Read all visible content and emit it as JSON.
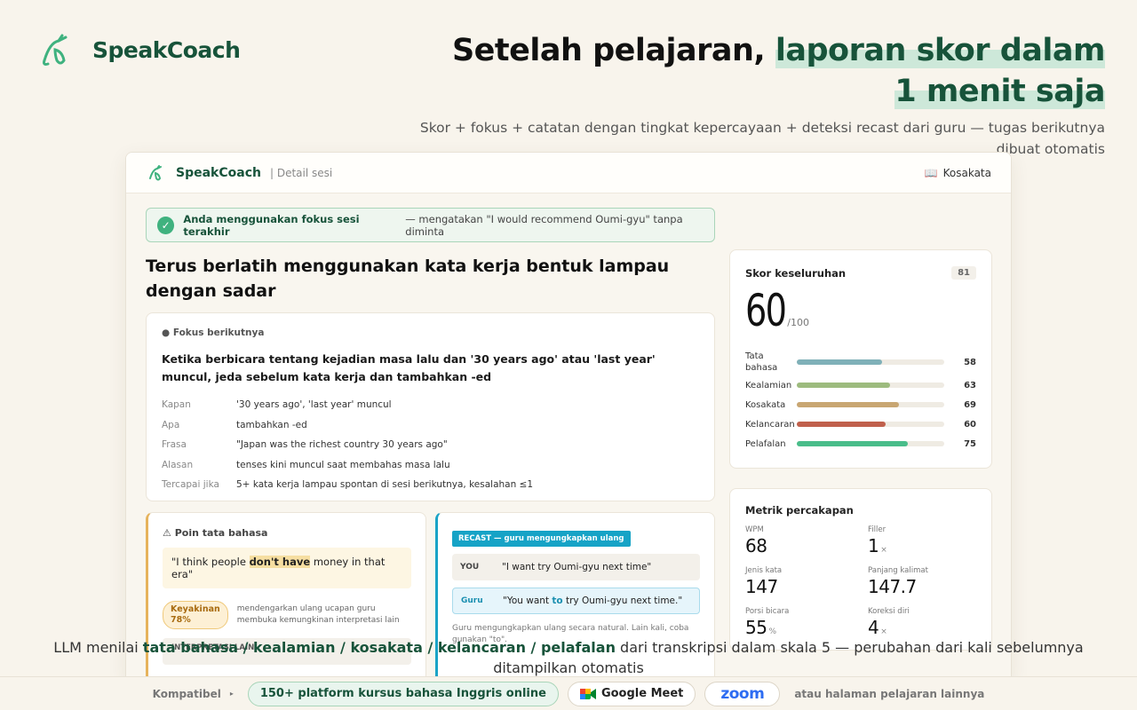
{
  "brand": {
    "name": "SpeakCoach"
  },
  "headline": {
    "prefix": "Setelah pelajaran, ",
    "highlight": "laporan skor dalam 1 menit saja",
    "subtitle": "Skor + fokus + catatan dengan tingkat kepercayaan + deteksi recast dari guru — tugas berikutnya dibuat otomatis"
  },
  "app": {
    "brand": "SpeakCoach",
    "breadcrumb": "| Detail sesi",
    "vocab_icon": "book-icon",
    "vocab_label": "Kosakata",
    "banner": {
      "icon": "check-icon",
      "bold": "Anda menggunakan fokus sesi terakhir",
      "rest": "— mengatakan \"I would recommend Oumi-gyu\" tanpa diminta"
    },
    "title": "Terus berlatih menggunakan kata kerja bentuk lampau dengan sadar",
    "focus": {
      "kicker": "● Fokus berikutnya",
      "text": "Ketika berbicara tentang kejadian masa lalu dan '30 years ago' atau 'last year' muncul, jeda sebelum kata kerja dan tambahkan -ed",
      "rows": [
        {
          "key": "Kapan",
          "value": "'30 years ago', 'last year' muncul"
        },
        {
          "key": "Apa",
          "value": "tambahkan -ed"
        },
        {
          "key": "Frasa",
          "value": "\"Japan was the richest country 30 years ago\""
        },
        {
          "key": "Alasan",
          "value": "tenses kini muncul saat membahas masa lalu"
        },
        {
          "key": "Tercapai jika",
          "value": "5+ kata kerja lampau spontan di sesi berikutnya, kesalahan ≤1"
        }
      ]
    },
    "grammar": {
      "icon": "warning-icon",
      "title": "Poin tata bahasa",
      "quote_before": "\"I think people ",
      "quote_highlight": "don't have",
      "quote_after": " money in that era\"",
      "confidence_label": "Keyakinan",
      "confidence_value": "78%",
      "confidence_text": "mendengarkan ulang ucapan guru membuka kemungkinan interpretasi lain",
      "other_label": "INTERPRETASI LAIN"
    },
    "recast": {
      "tag": "RECAST — guru mengungkapkan ulang",
      "you_label": "YOU",
      "you_text": "\"I want try Oumi-gyu next time\"",
      "guru_label": "Guru",
      "guru_before": "\"You want ",
      "guru_highlight": "to",
      "guru_after": " try Oumi-gyu next time.\"",
      "note": "Guru mengungkapkan ulang secara natural. Lain kali, coba gunakan \"to\"."
    },
    "score": {
      "title": "Skor keseluruhan",
      "previous": "81",
      "value": "60",
      "denominator": "/100",
      "bars": [
        {
          "label": "Tata bahasa",
          "value": 58,
          "color": "#7fb0b8"
        },
        {
          "label": "Kealamian",
          "value": 63,
          "color": "#9dbb7e"
        },
        {
          "label": "Kosakata",
          "value": 69,
          "color": "#c8a672"
        },
        {
          "label": "Kelancaran",
          "value": 60,
          "color": "#c0604c"
        },
        {
          "label": "Pelafalan",
          "value": 75,
          "color": "#49bd8a"
        }
      ]
    },
    "metrics": {
      "title": "Metrik percakapan",
      "items": [
        {
          "label": "WPM",
          "value": "68",
          "unit": ""
        },
        {
          "label": "Filler",
          "value": "1",
          "unit": "×"
        },
        {
          "label": "Jenis kata",
          "value": "147",
          "unit": ""
        },
        {
          "label": "Panjang kalimat",
          "value": "147.7",
          "unit": ""
        },
        {
          "label": "Porsi bicara",
          "value": "55",
          "unit": "%"
        },
        {
          "label": "Koreksi diri",
          "value": "4",
          "unit": "×"
        }
      ]
    }
  },
  "caption": {
    "before": "LLM menilai ",
    "bold": "tata bahasa / kealamian / kosakata / kelancaran / pelafalan",
    "after": " dari transkripsi dalam skala 5 — perubahan dari kali sebelumnya ditampilkan otomatis"
  },
  "compat": {
    "label": "Kompatibel",
    "arrow": "▸",
    "platforms": "150+ platform kursus bahasa Inggris online",
    "meet": "Google Meet",
    "zoom": "zoom",
    "tail": "atau halaman pelajaran lainnya"
  }
}
